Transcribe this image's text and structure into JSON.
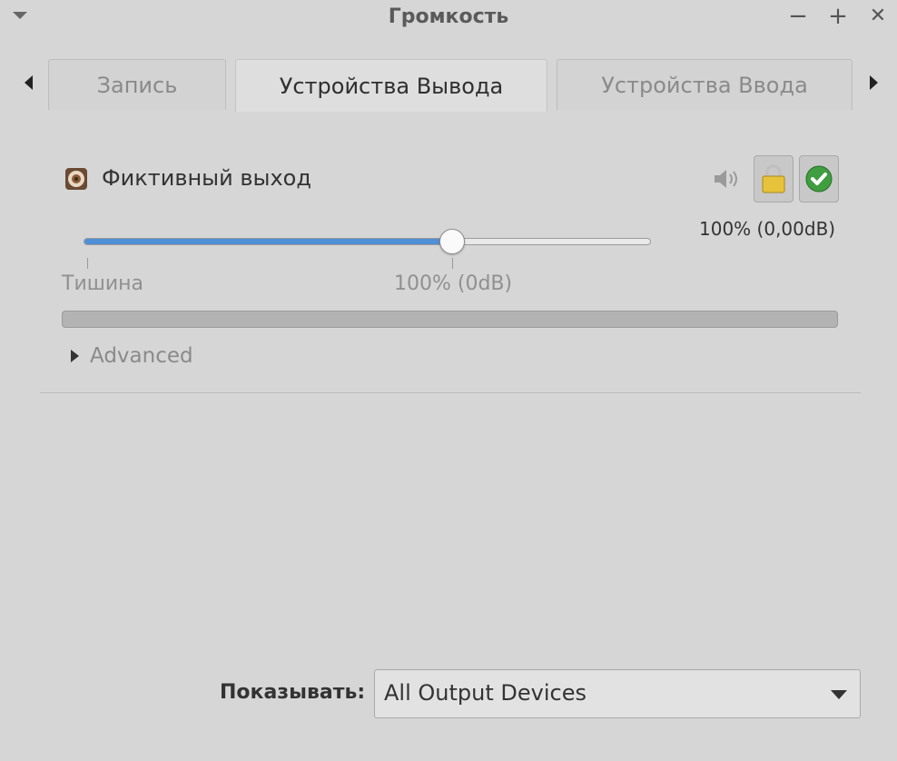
{
  "window": {
    "title": "Громкость",
    "minimize_label": "−",
    "maximize_label": "+",
    "close_label": "✕"
  },
  "tabs": [
    {
      "label": "Запись",
      "active": false
    },
    {
      "label": "Устройства Вывода",
      "active": true
    },
    {
      "label": "Устройства Ввода",
      "active": false
    }
  ],
  "device": {
    "name": "Фиктивный выход",
    "volume_readout": "100% (0,00dB)",
    "volume_fraction": 0.65,
    "icons": [
      "speaker-icon",
      "volume-icon",
      "lock-icon",
      "checkmark-icon"
    ]
  },
  "slider": {
    "label_silence": "Тишина",
    "label_100": "100% (0dB)"
  },
  "advanced": {
    "label": "Advanced"
  },
  "footer": {
    "show_label": "Показывать:",
    "show_value": "All Output Devices"
  },
  "colors": {
    "background": "#d6d6d6",
    "accent": "#4f8fd6",
    "lock": "#e6c33a",
    "check": "#3f9e3f"
  }
}
